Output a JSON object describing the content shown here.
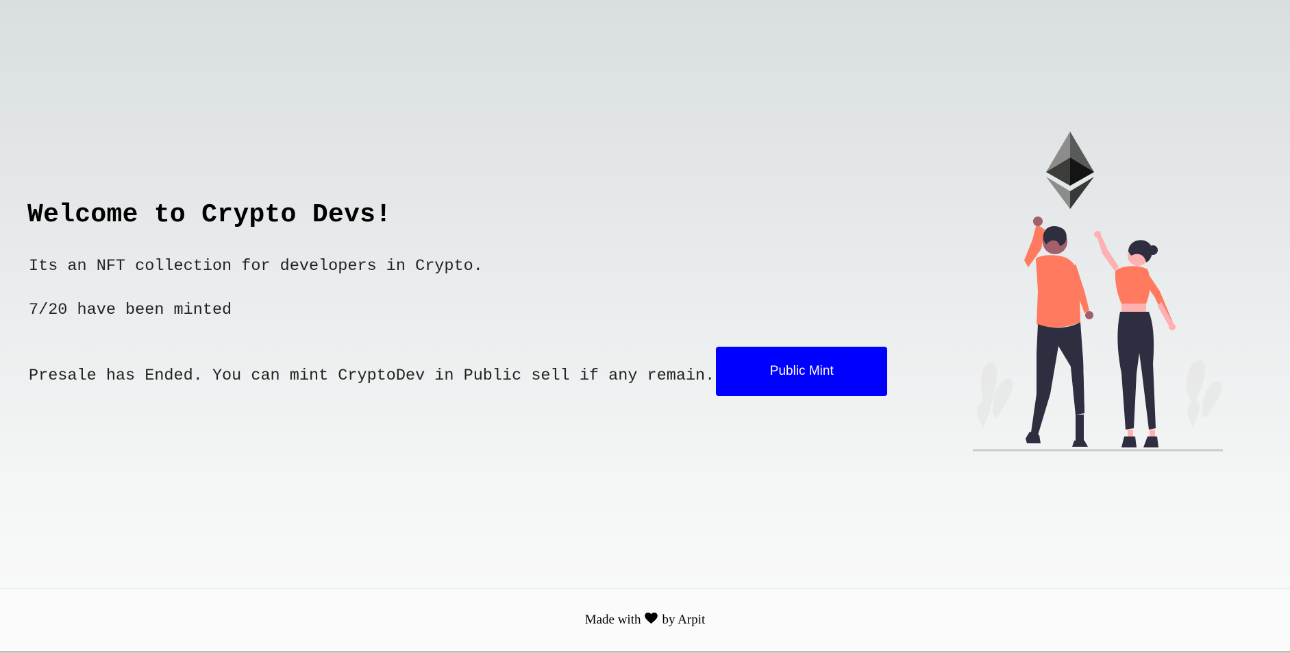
{
  "hero": {
    "title": "Welcome to Crypto Devs!",
    "description": "Its an NFT collection for developers in Crypto.",
    "minted_status": "7/20 have been minted",
    "presale_message": "Presale has Ended. You can mint CryptoDev in Public sell if any remain.",
    "mint_button_label": "Public Mint"
  },
  "illustration": {
    "icon": "ethereum-icon",
    "scene": "people-celebrating-illustration",
    "colors": {
      "shirt": "#ff7a5f",
      "pants": "#2f2e41",
      "skin_light": "#ffb0b0",
      "skin_dark": "#a0616a",
      "ground": "#cccccc"
    }
  },
  "footer": {
    "made_with": "Made with",
    "heart_icon": "heart-icon",
    "by_author": "by Arpit"
  },
  "colors": {
    "button": "#0000ff",
    "button_text": "#ffffff"
  }
}
